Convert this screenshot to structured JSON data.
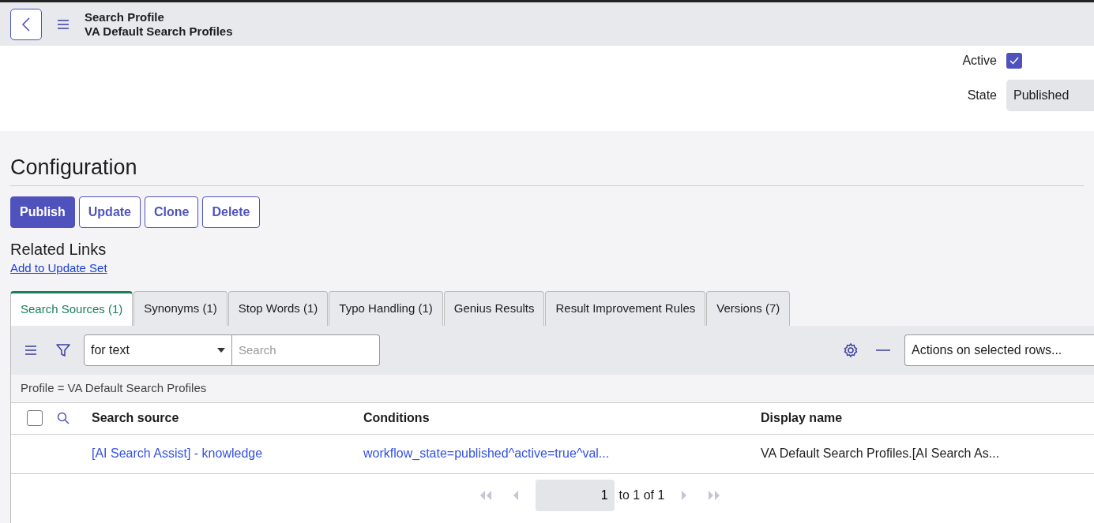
{
  "header": {
    "title": "Search Profile",
    "subtitle": "VA Default Search Profiles"
  },
  "fields": [
    {
      "label": "Active",
      "kind": "checkbox",
      "checked": true
    },
    {
      "label": "State",
      "kind": "text",
      "value": "Published"
    }
  ],
  "section_title": "Configuration",
  "buttons": [
    {
      "label": "Publish",
      "primary": true
    },
    {
      "label": "Update",
      "primary": false
    },
    {
      "label": "Clone",
      "primary": false
    },
    {
      "label": "Delete",
      "primary": false
    }
  ],
  "related_links": {
    "title": "Related Links",
    "links": [
      "Add to Update Set"
    ]
  },
  "tabs": [
    {
      "label": "Search Sources (1)",
      "selected": true
    },
    {
      "label": "Synonyms (1)",
      "selected": false
    },
    {
      "label": "Stop Words (1)",
      "selected": false
    },
    {
      "label": "Typo Handling (1)",
      "selected": false
    },
    {
      "label": "Genius Results",
      "selected": false
    },
    {
      "label": "Result Improvement Rules",
      "selected": false
    },
    {
      "label": "Versions (7)",
      "selected": false
    }
  ],
  "list_toolbar": {
    "search_field_select": "for text",
    "search_placeholder": "Search",
    "actions_select": "Actions on selected rows..."
  },
  "filter_breadcrumb": "Profile = VA Default Search Profiles",
  "table": {
    "select_all_checked": false,
    "columns": [
      "Search source",
      "Conditions",
      "Display name"
    ],
    "rows": [
      {
        "cells": [
          {
            "text": "[AI Search Assist] - knowledge",
            "link": true
          },
          {
            "text": "workflow_state=published^active=true^val...",
            "link": true
          },
          {
            "text": "VA Default Search Profiles.[AI Search As...",
            "link": false
          }
        ]
      }
    ]
  },
  "pagination": {
    "page": "1",
    "summary": "to 1 of 1"
  }
}
